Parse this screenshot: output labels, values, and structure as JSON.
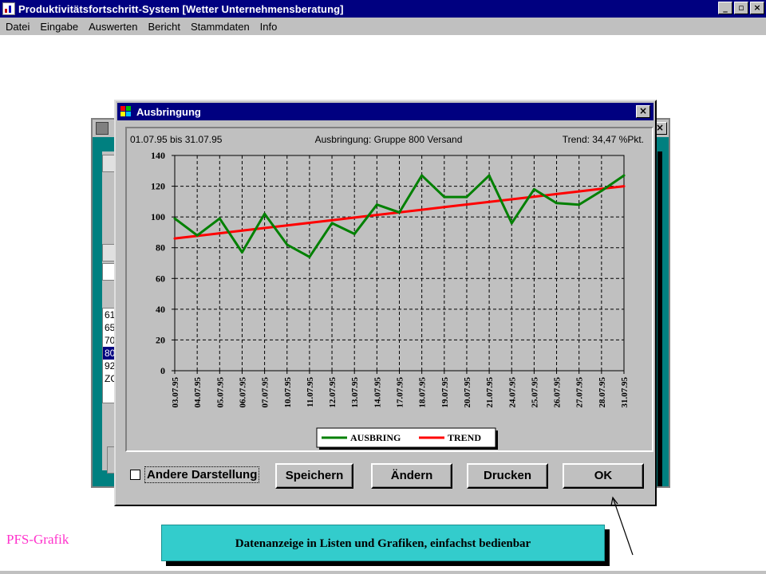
{
  "app": {
    "title": "Produktivitätsfortschritt-System [Wetter Unternehmensberatung]",
    "controls": [
      "_",
      "▫",
      "×"
    ],
    "menu": [
      "Datei",
      "Eingabe",
      "Auswerten",
      "Bericht",
      "Stammdaten",
      "Info"
    ]
  },
  "background_dialog": {
    "list_items": [
      "61",
      "65",
      "70",
      "80",
      "92",
      "ZC"
    ],
    "selected_index": 3,
    "close_label": "×"
  },
  "dialog": {
    "title": "Ausbringung",
    "close_label": "×",
    "checkbox_label": "Andere Darstellung",
    "checkbox_checked": false,
    "buttons": [
      "Speichern",
      "Ändern",
      "Drucken",
      "OK"
    ]
  },
  "chart_data": {
    "type": "line",
    "header_left": "01.07.95 bis 31.07.95",
    "header_center": "Ausbringung: Gruppe 800 Versand",
    "header_right": "Trend: 34,47 %Pkt.",
    "categories": [
      "03.07.95",
      "04.07.95",
      "05.07.95",
      "06.07.95",
      "07.07.95",
      "10.07.95",
      "11.07.95",
      "12.07.95",
      "13.07.95",
      "14.07.95",
      "17.07.95",
      "18.07.95",
      "19.07.95",
      "20.07.95",
      "21.07.95",
      "24.07.95",
      "25.07.95",
      "26.07.95",
      "27.07.95",
      "28.07.95",
      "31.07.95"
    ],
    "series": [
      {
        "name": "AUSBRING",
        "color": "#008000",
        "values": [
          99,
          88,
          99,
          77,
          102,
          82,
          74,
          96,
          89,
          108,
          103,
          127,
          113,
          113,
          127,
          96,
          118,
          109,
          108,
          117,
          127
        ]
      },
      {
        "name": "TREND",
        "color": "#ff0000",
        "values": [
          86,
          87.7,
          89.4,
          91.1,
          92.8,
          94.5,
          96.2,
          97.9,
          99.6,
          101.3,
          103,
          104.7,
          106.4,
          108.1,
          109.8,
          111.5,
          113.2,
          114.9,
          116.6,
          118.3,
          120
        ]
      }
    ],
    "ylim": [
      0,
      140
    ],
    "yticks": [
      0,
      20,
      40,
      60,
      80,
      100,
      120,
      140
    ],
    "grid": true,
    "legend_position": "bottom-center"
  },
  "caption": {
    "label": "PFS-Grafik",
    "text": "Datenanzeige in Listen und Grafiken, einfachst bedienbar"
  }
}
